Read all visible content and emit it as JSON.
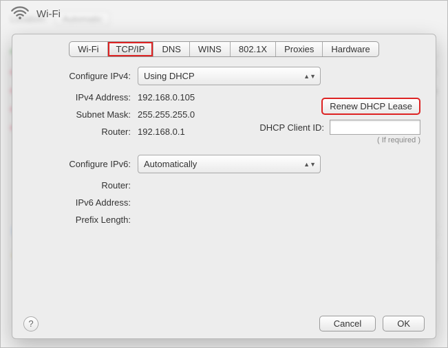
{
  "header": {
    "title": "Wi-Fi"
  },
  "tabs": [
    "Wi-Fi",
    "TCP/IP",
    "DNS",
    "WINS",
    "802.1X",
    "Proxies",
    "Hardware"
  ],
  "ipv4": {
    "configure_label": "Configure IPv4:",
    "configure_value": "Using DHCP",
    "address_label": "IPv4 Address:",
    "address_value": "192.168.0.105",
    "subnet_label": "Subnet Mask:",
    "subnet_value": "255.255.255.0",
    "router_label": "Router:",
    "router_value": "192.168.0.1"
  },
  "dhcp": {
    "renew_label": "Renew DHCP Lease",
    "client_id_label": "DHCP Client ID:",
    "client_id_value": "",
    "if_required": "( If required )"
  },
  "ipv6": {
    "configure_label": "Configure IPv6:",
    "configure_value": "Automatically",
    "router_label": "Router:",
    "router_value": "",
    "address_label": "IPv6 Address:",
    "address_value": "",
    "prefix_label": "Prefix Length:",
    "prefix_value": ""
  },
  "footer": {
    "help": "?",
    "cancel": "Cancel",
    "ok": "OK"
  },
  "colors": {
    "highlight": "#d22"
  }
}
